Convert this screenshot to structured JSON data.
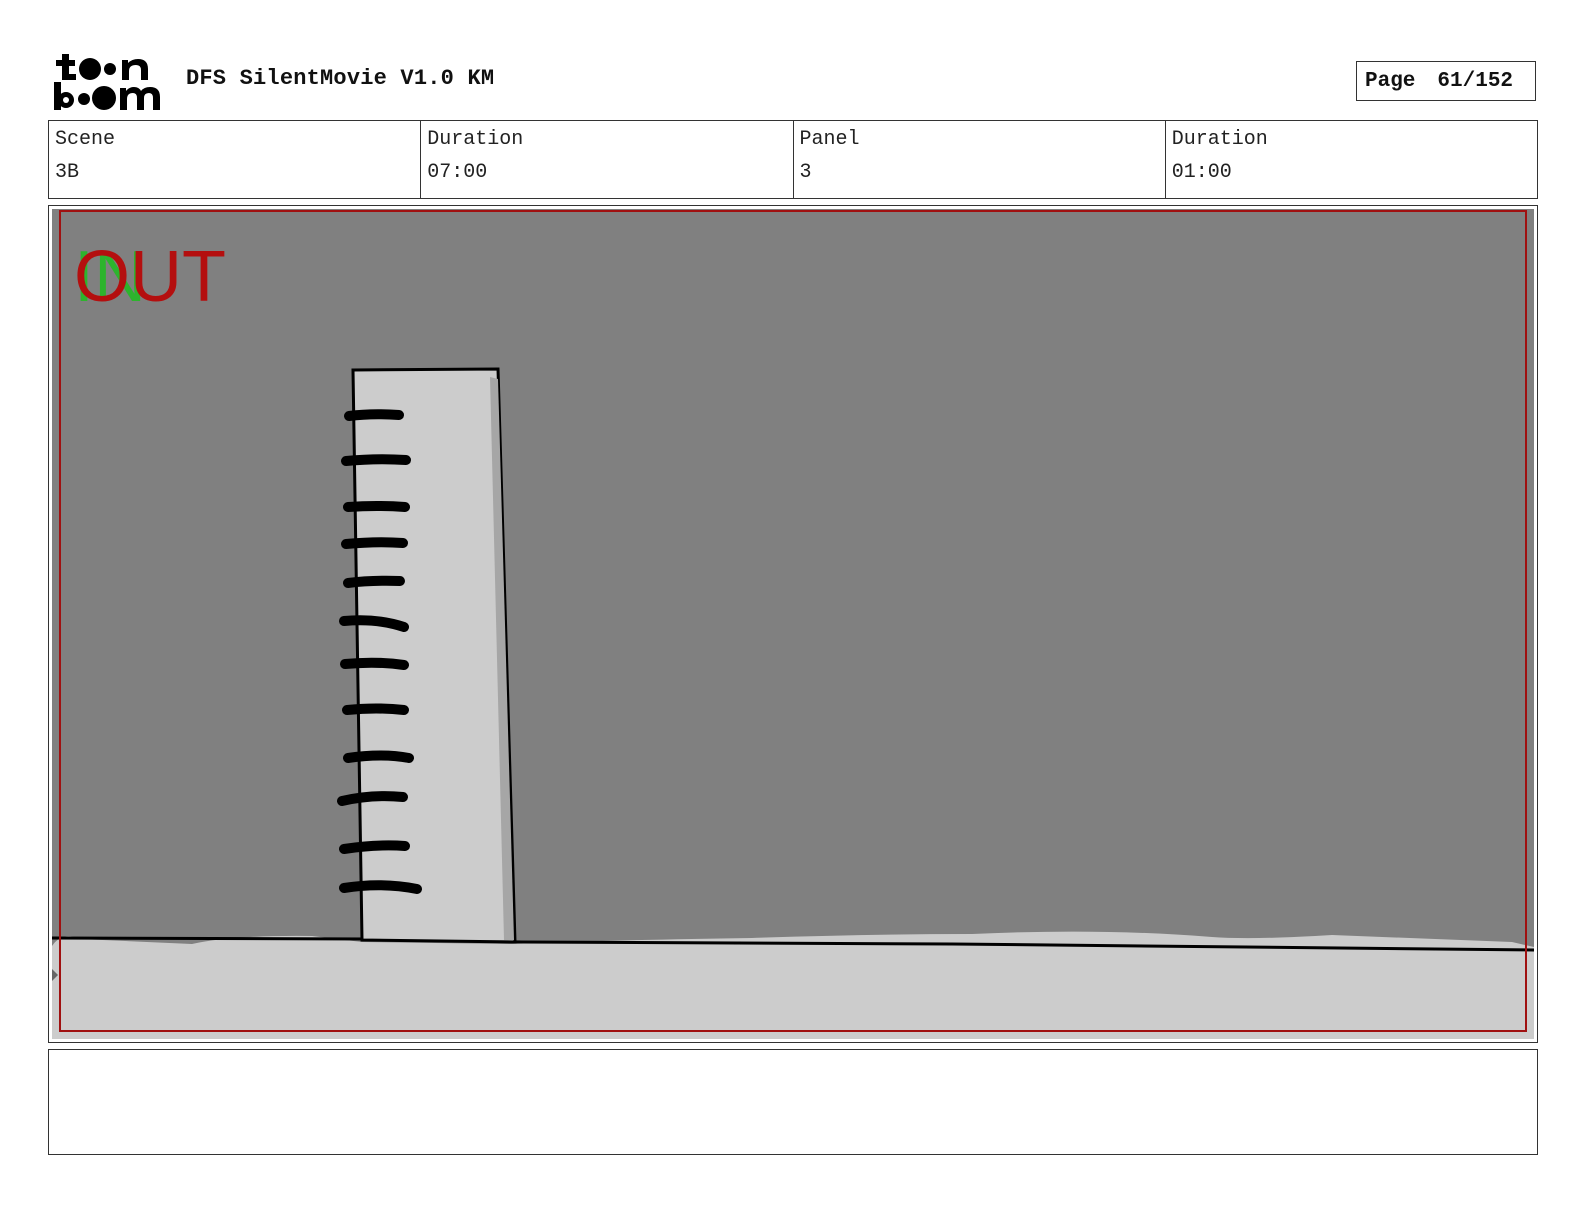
{
  "header": {
    "project_title": "DFS SilentMovie V1.0 KM",
    "page_label": "Page",
    "page_number": "61/152",
    "logo_text": "toon boom"
  },
  "info": {
    "scene_label": "Scene",
    "scene_value": "3B",
    "scene_duration_label": "Duration",
    "scene_duration_value": "07:00",
    "panel_label": "Panel",
    "panel_value": "3",
    "panel_duration_label": "Duration",
    "panel_duration_value": "01:00"
  },
  "panel": {
    "in_marker": "IN",
    "out_marker": "OUT",
    "in_color": "#2db42d",
    "out_color": "#b40f0f",
    "background_color": "#808080",
    "ground_color": "#cccccc",
    "safe_frame_color": "#a01010"
  },
  "notes": {
    "text": ""
  }
}
